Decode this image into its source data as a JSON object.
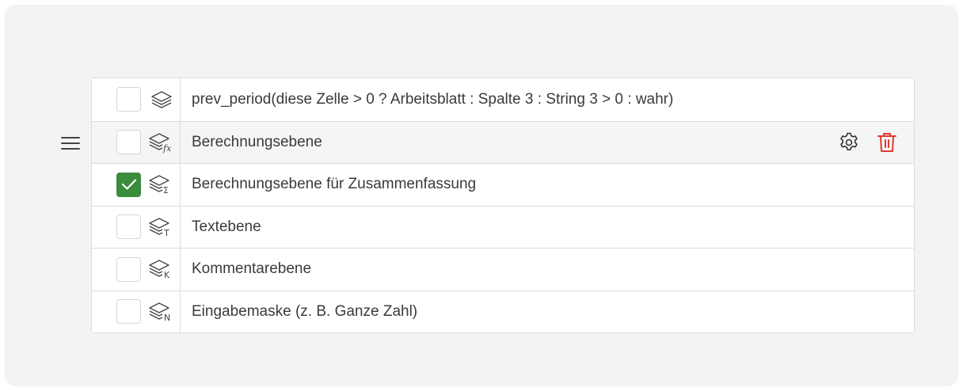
{
  "rows": [
    {
      "label": "prev_period(diese Zelle > 0 ? Arbeitsblatt : Spalte 3 : String 3 > 0 : wahr)",
      "checked": false,
      "icon": "layers-icon",
      "badge": ""
    },
    {
      "label": "Berechnungsebene",
      "checked": false,
      "icon": "layers-fx-icon",
      "badge": "fx"
    },
    {
      "label": "Berechnungsebene für Zusammenfassung",
      "checked": true,
      "icon": "layers-sigma-icon",
      "badge": "Σ"
    },
    {
      "label": "Textebene",
      "checked": false,
      "icon": "layers-text-icon",
      "badge": "T"
    },
    {
      "label": "Kommentarebene",
      "checked": false,
      "icon": "layers-comment-icon",
      "badge": "K"
    },
    {
      "label": "Eingabemaske (z. B. Ganze Zahl)",
      "checked": false,
      "icon": "layers-number-icon",
      "badge": "N"
    }
  ],
  "colors": {
    "checked": "#3a8c3f",
    "delete": "#e0382b",
    "text": "#3a3a3a",
    "border": "#dcdcdc"
  }
}
